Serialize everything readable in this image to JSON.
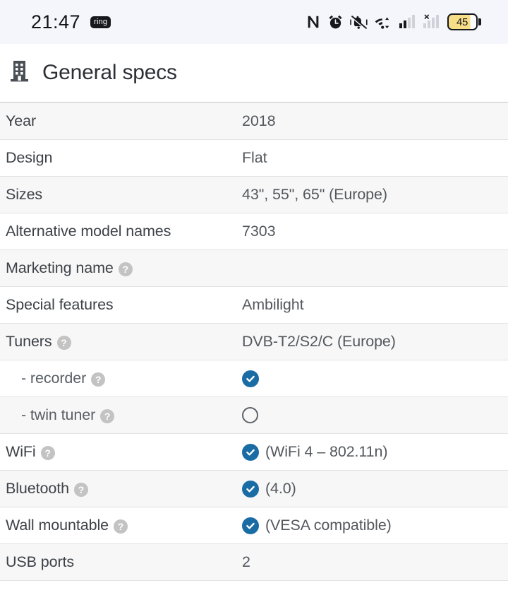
{
  "status_bar": {
    "time": "21:47",
    "ring_badge": "ring",
    "icons": [
      "nfc-icon",
      "alarm-clock-icon",
      "bell-muted-vibrate-icon",
      "wifi-data-transfer-icon",
      "cellular-signal-icon",
      "cellular-no-sim-icon"
    ],
    "battery_level": "45"
  },
  "header": {
    "icon": "building-icon",
    "title": "General specs"
  },
  "specs": {
    "rows": [
      {
        "label": "Year",
        "sub": false,
        "help": false,
        "mark": "none",
        "value": "2018"
      },
      {
        "label": "Design",
        "sub": false,
        "help": false,
        "mark": "none",
        "value": "Flat"
      },
      {
        "label": "Sizes",
        "sub": false,
        "help": false,
        "mark": "none",
        "value": "43\", 55\", 65\" (Europe)"
      },
      {
        "label": "Alternative model names",
        "sub": false,
        "help": false,
        "mark": "none",
        "value": "7303"
      },
      {
        "label": "Marketing name",
        "sub": false,
        "help": true,
        "mark": "none",
        "value": ""
      },
      {
        "label": "Special features",
        "sub": false,
        "help": false,
        "mark": "none",
        "value": "Ambilight"
      },
      {
        "label": "Tuners",
        "sub": false,
        "help": true,
        "mark": "none",
        "value": "DVB-T2/S2/C (Europe)"
      },
      {
        "label": "- recorder",
        "sub": true,
        "help": true,
        "mark": "yes",
        "value": ""
      },
      {
        "label": "- twin tuner",
        "sub": true,
        "help": true,
        "mark": "no",
        "value": ""
      },
      {
        "label": "WiFi",
        "sub": false,
        "help": true,
        "mark": "yes",
        "value": "(WiFi 4 – 802.11n)"
      },
      {
        "label": "Bluetooth",
        "sub": false,
        "help": true,
        "mark": "yes",
        "value": "(4.0)"
      },
      {
        "label": "Wall mountable",
        "sub": false,
        "help": true,
        "mark": "yes",
        "value": "(VESA compatible)"
      },
      {
        "label": "USB ports",
        "sub": false,
        "help": false,
        "mark": "none",
        "value": "2"
      }
    ]
  },
  "colors": {
    "check_blue": "#1a6ca4",
    "help_gray": "#c3c3c3",
    "row_shade": "#f7f7f7",
    "battery_fill": "#f7dd85",
    "status_bg": "#f5f6fc"
  }
}
